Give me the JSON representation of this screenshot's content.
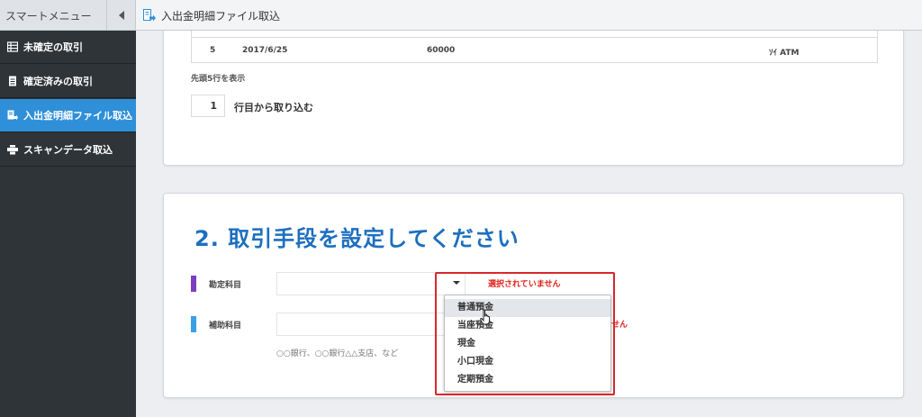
{
  "sidebar": {
    "title": "スマートメニュー",
    "items": [
      {
        "label": "未確定の取引",
        "icon": "grid-list-icon"
      },
      {
        "label": "確定済みの取引",
        "icon": "document-icon"
      },
      {
        "label": "入出金明細ファイル取込",
        "icon": "file-import-icon"
      },
      {
        "label": "スキャンデータ取込",
        "icon": "scanner-icon"
      }
    ],
    "active_index": 2
  },
  "topbar": {
    "title": "入出金明細ファイル取込",
    "icon": "file-import-icon"
  },
  "preview": {
    "row": {
      "no": "5",
      "date": "2017/6/25",
      "amount": "60000",
      "description": "ｿｲ ATM"
    },
    "note": "先頭5行を表示",
    "start_row_value": "1",
    "start_row_label": "行目から取り込む"
  },
  "section2": {
    "title": "2. 取引手段を設定してください",
    "account_label": "勘定科目",
    "sub_account_label": "補助科目",
    "account_error": "選択されていません",
    "sub_account_error_fragment": "せん",
    "hint": "○○銀行、○○銀行△△支店、など",
    "account_bar_color": "#7b3fbf",
    "sub_account_bar_color": "#3aa0e6"
  },
  "dropdown": {
    "options": [
      "普通預金",
      "当座預金",
      "現金",
      "小口現金",
      "定期預金"
    ],
    "hovered_index": 0
  },
  "colors": {
    "accent": "#2f8fd8",
    "title_blue": "#1d6fbf",
    "error": "#e0201b",
    "highlight": "#d8272a"
  }
}
